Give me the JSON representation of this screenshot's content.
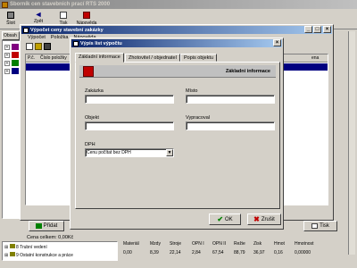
{
  "app": {
    "title": "Sborník cen stavebních prací RTS 2000",
    "toolbar": [
      {
        "label": "Šloit",
        "icon": "exit-door-icon"
      },
      {
        "label": "Zpět",
        "icon": "back-arrow-icon"
      },
      {
        "label": "Tisk",
        "icon": "printer-icon"
      },
      {
        "label": "Nápověda",
        "icon": "help-book-icon"
      }
    ],
    "left_tab": "Obsah",
    "tree_rows": [
      {
        "number": "8",
        "label": "Trubní vedení"
      },
      {
        "number": "9",
        "label": "Ostatní konstrukce a práce"
      }
    ],
    "add_button": "Přidat",
    "print_button": "Tisk",
    "total_label": "Cena celkem:",
    "total_value": "0,00Kč",
    "grid_headers": [
      "Materiál",
      "Mzdy",
      "Stroje",
      "OPN I",
      "OPN II",
      "Režie",
      "Zisk",
      "Hmot",
      "Hmotnost"
    ],
    "grid_values": [
      "0,00",
      "8,39",
      "22,14",
      "2,84",
      "67,54",
      "88,79",
      "36,97",
      "0,16",
      "0,00000"
    ]
  },
  "mid_window": {
    "title": "Výpočet ceny stavební zakázky",
    "menu": [
      "Výpočet",
      "Položka",
      "Nápověda"
    ],
    "col_headers": [
      "P.č.",
      "Číslo položky"
    ],
    "right_col_header": "ena"
  },
  "dialog": {
    "title": "Výpis list výpočtu",
    "tabs": [
      "Základní informace",
      "Zhotovitel / objednatel",
      "Popis objektu"
    ],
    "section_title": "Základní informace",
    "labels": {
      "zakazka": "Zakázka",
      "misto": "Místo",
      "objekt": "Objekt",
      "vypracoval": "Vypracoval",
      "dph": "DPH"
    },
    "values": {
      "zakazka": "",
      "misto": "",
      "objekt": "",
      "vypracoval": ""
    },
    "dph_selected": "Cenu počítat bez DPH",
    "ok_label": "OK",
    "cancel_label": "Zrušit"
  },
  "colors": {
    "titlebar": "#0a246a",
    "selection": "#000080",
    "face": "#d4d0c8"
  }
}
